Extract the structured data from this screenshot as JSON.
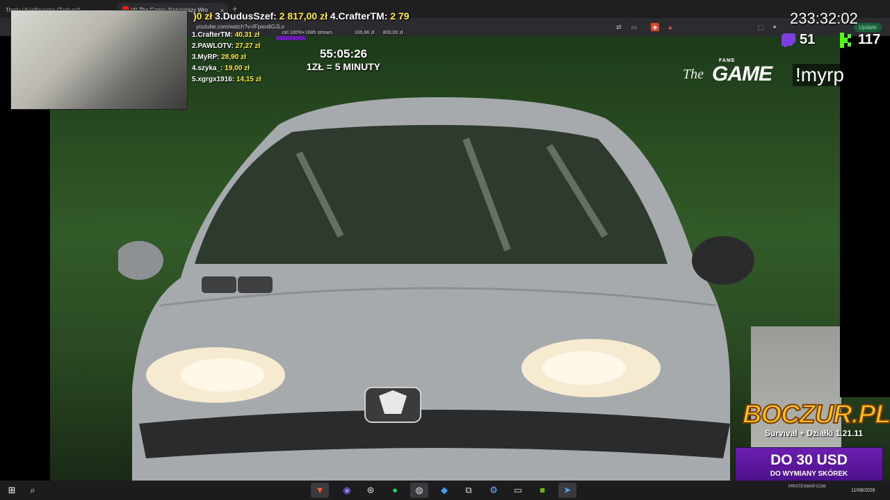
{
  "browser": {
    "tabs": [
      {
        "label": "Tipply | Konfigurator (Twój cel)"
      },
      {
        "label": "(4) The Game: Największy Wro"
      }
    ],
    "new_tab": "+",
    "close_glyph": "×",
    "url": "youtube.com/watch?v=lFpavdiGJLo",
    "update_label": "Update"
  },
  "ticker": {
    "part1_amt": ")0 zł",
    "part2_name": "3.DudusSzef:",
    "part2_amt": "2 817,00 zł",
    "part3_name": "4.CrafterTM:",
    "part3_amt": "2 79"
  },
  "leaderboard": [
    {
      "name": "1.CrafterTM:",
      "amount": "40,31 zł"
    },
    {
      "name": "2.PAWLOTV:",
      "amount": "27,27 zł"
    },
    {
      "name": "3.MyRP:",
      "amount": "28,90 zł"
    },
    {
      "name": "4.szyka_:",
      "amount": "19,00 zł"
    },
    {
      "name": "5.xgrgx1916:",
      "amount": "14,15 zł"
    }
  ],
  "goal": {
    "label": "cel 100%+168h stream",
    "current": "165,96 zł",
    "target": "800,00 zł"
  },
  "subathon": {
    "timer": "55:05:26",
    "rate": "1ZŁ = 5 MINUTY"
  },
  "stream_time": "233:32:02",
  "viewers": {
    "twitch": "51",
    "kick": "117"
  },
  "overlay": {
    "logo_fame": "FAME",
    "logo_the": "The",
    "logo_game": "GAME",
    "command": "!myrp"
  },
  "ads": {
    "boczur_title": "BOCZUR.PL",
    "boczur_sub": "Survival + Działki 1.21.11",
    "usd_big": "DO 30 USD",
    "usd_small": "DO WYMIANY SKÓREK",
    "pirate": "PIRATESWAP.COM"
  },
  "taskbar": {
    "date": "11/08/2026",
    "icons": [
      "windows-icon",
      "search-icon",
      "brave-icon",
      "discord-icon",
      "steam-icon",
      "spotify-icon",
      "obs-icon",
      "vscode-icon",
      "network-icon",
      "tool-icon",
      "terminal-icon",
      "nvidia-icon",
      "telegram-icon"
    ]
  }
}
